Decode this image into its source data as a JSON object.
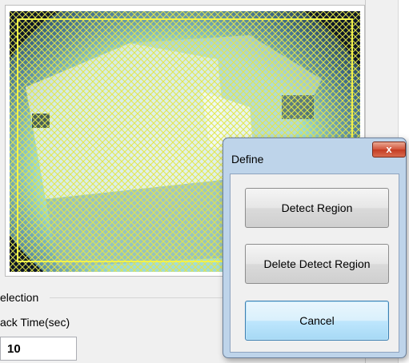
{
  "options_panel": {
    "group_label": "election",
    "track_time_label": "ack Time(sec)",
    "track_time_value": "10"
  },
  "dialog": {
    "title": "Define",
    "close_glyph": "x",
    "buttons": {
      "detect_region": "Detect Region",
      "delete_detect_region": "Delete Detect Region",
      "cancel": "Cancel"
    }
  },
  "colors": {
    "region_hatch": "#e3e64a",
    "region_border": "#f2f24a",
    "dialog_frame": "#bed4ea",
    "close_button": "#c33b22",
    "focused_button": "#3c7fb1"
  },
  "icons": {
    "close": "close-icon"
  }
}
